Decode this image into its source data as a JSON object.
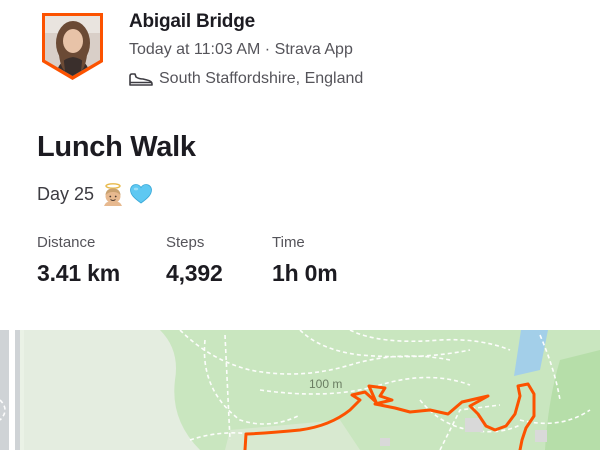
{
  "athlete": {
    "name": "Abigail Bridge",
    "meta": "Today at 11:03 AM · Strava App",
    "location": "South Staffordshire, England",
    "avatar_icon": "avatar-photo",
    "shoe_icon": "shoe-icon"
  },
  "activity": {
    "title": "Lunch Walk",
    "description": "Day 25",
    "description_emojis": [
      "angel-face-emoji",
      "blue-heart-emoji"
    ]
  },
  "stats": [
    {
      "label": "Distance",
      "value": "3.41 km"
    },
    {
      "label": "Steps",
      "value": "4,392"
    },
    {
      "label": "Time",
      "value": "1h 0m"
    }
  ],
  "map": {
    "contour_label": "100 m",
    "route_color": "#fc5200",
    "park_color": "#c9e6bf",
    "water_color": "#9fd0ec"
  },
  "colors": {
    "accent": "#fc5200",
    "text_primary": "#1c1b21",
    "text_secondary": "#55545a"
  }
}
